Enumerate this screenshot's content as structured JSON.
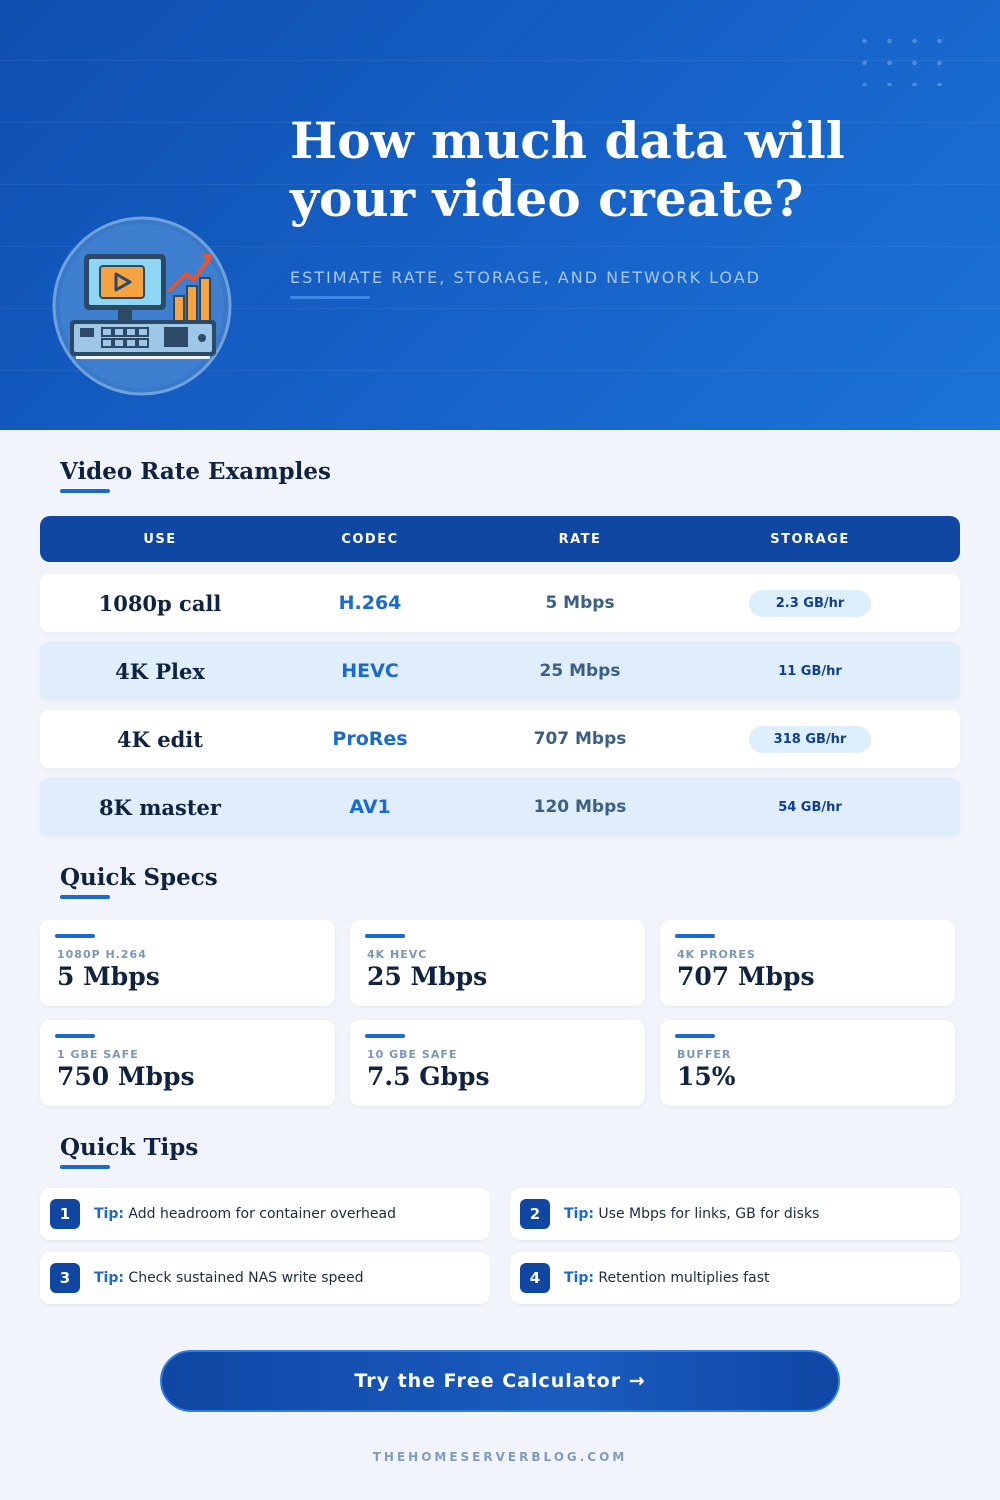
{
  "hero": {
    "title_line1": "How much data will",
    "title_line2": "your video create?",
    "subtitle": "ESTIMATE RATE, STORAGE, AND NETWORK LOAD",
    "icon": "monitor-chart-icon"
  },
  "rate_section": {
    "title": "Video Rate Examples",
    "headers": [
      "USE",
      "CODEC",
      "RATE",
      "STORAGE"
    ],
    "rows": [
      {
        "use": "1080p call",
        "codec": "H.264",
        "rate": "5 Mbps",
        "storage": "2.3 GB/hr"
      },
      {
        "use": "4K Plex",
        "codec": "HEVC",
        "rate": "25 Mbps",
        "storage": "11 GB/hr"
      },
      {
        "use": "4K edit",
        "codec": "ProRes",
        "rate": "707 Mbps",
        "storage": "318 GB/hr"
      },
      {
        "use": "8K master",
        "codec": "AV1",
        "rate": "120 Mbps",
        "storage": "54 GB/hr"
      }
    ]
  },
  "specs_section": {
    "title": "Quick Specs",
    "cards": [
      {
        "label": "1080P H.264",
        "value": "5 Mbps"
      },
      {
        "label": "4K HEVC",
        "value": "25 Mbps"
      },
      {
        "label": "4K PRORES",
        "value": "707 Mbps"
      },
      {
        "label": "1 GBE SAFE",
        "value": "750 Mbps"
      },
      {
        "label": "10 GBE SAFE",
        "value": "7.5 Gbps"
      },
      {
        "label": "BUFFER",
        "value": "15%"
      }
    ]
  },
  "tips_section": {
    "title": "Quick Tips",
    "prefix": "Tip:",
    "tips": [
      {
        "num": "1",
        "text": "Add headroom for container overhead"
      },
      {
        "num": "2",
        "text": "Use Mbps for links, GB for disks"
      },
      {
        "num": "3",
        "text": "Check sustained NAS write speed"
      },
      {
        "num": "4",
        "text": "Retention multiplies fast"
      }
    ]
  },
  "cta": {
    "label": "Try the Free Calculator →"
  },
  "footer": {
    "text": "THEHOMESERVERBLOG.COM"
  },
  "colors": {
    "primary": "#0f47a3",
    "accent": "#1a6ad0",
    "hero_bg": "#1662c8",
    "page_bg": "#f1f5fb"
  }
}
